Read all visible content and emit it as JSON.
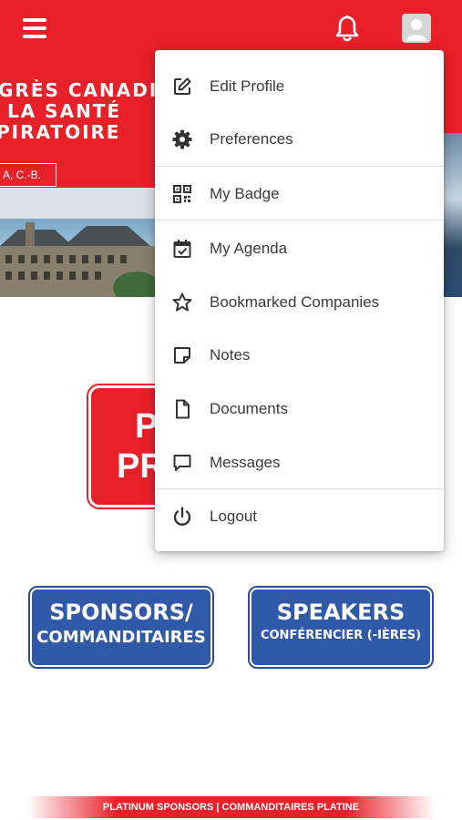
{
  "banner": {
    "title_lines": [
      "GRÈS CANADIE",
      "LA SANTÉ",
      "PIRATOIRE"
    ],
    "location": "A, C.-B."
  },
  "program_button": {
    "lines": [
      "P",
      "PR"
    ]
  },
  "buttons": {
    "sponsors_big": "SPONSORS/",
    "sponsors_small": "COMMANDITAIRES",
    "speakers_big": "SPEAKERS",
    "speakers_small": "CONFÉRENCIER (-IÈRES)"
  },
  "footer": {
    "platinum": "PLATINUM SPONSORS | COMMANDITAIRES PLATINE"
  },
  "menu": {
    "items": [
      {
        "label": "Edit Profile",
        "icon": "edit-icon"
      },
      {
        "label": "Preferences",
        "icon": "gear-icon"
      },
      {
        "label": "My Badge",
        "icon": "qr-code-icon"
      },
      {
        "label": "My Agenda",
        "icon": "calendar-check-icon"
      },
      {
        "label": "Bookmarked Companies",
        "icon": "star-icon"
      },
      {
        "label": "Notes",
        "icon": "note-icon"
      },
      {
        "label": "Documents",
        "icon": "document-icon"
      },
      {
        "label": "Messages",
        "icon": "message-icon"
      },
      {
        "label": "Logout",
        "icon": "power-icon"
      }
    ]
  },
  "colors": {
    "brand_red": "#e8202a",
    "button_blue": "#3059a8",
    "menu_text": "#3a3a3a"
  }
}
